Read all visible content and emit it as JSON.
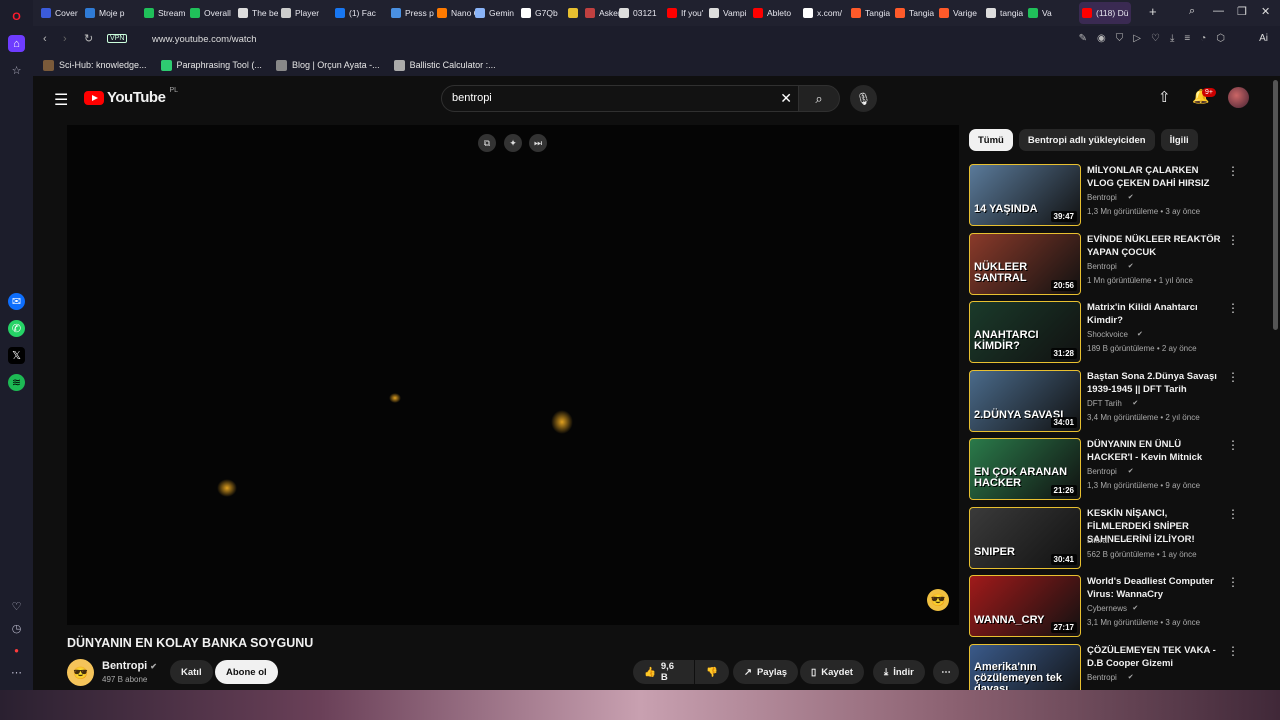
{
  "tabs": [
    {
      "label": "Cover",
      "color": "#3b5bdb"
    },
    {
      "label": "Moje p",
      "color": "#2f7bd6"
    },
    {
      "label": "Stream",
      "color": "#20c05a"
    },
    {
      "label": "Overall",
      "color": "#20c05a"
    },
    {
      "label": "The be",
      "color": "#dddddd"
    },
    {
      "label": "Player",
      "color": "#cccccc"
    },
    {
      "label": "(1) Fac",
      "color": "#1877f2"
    },
    {
      "label": "Press p",
      "color": "#4a90e2"
    },
    {
      "label": "Nano C",
      "color": "#ff7a00"
    },
    {
      "label": "Gemin",
      "color": "#8ab4f8"
    },
    {
      "label": "G7Qb",
      "color": "#ffffff"
    },
    {
      "label": "",
      "color": "#e8c030"
    },
    {
      "label": "Askerl",
      "color": "#c04040"
    },
    {
      "label": "03121",
      "color": "#dddddd"
    },
    {
      "label": "If you'",
      "color": "#ff0000"
    },
    {
      "label": "Vampi",
      "color": "#dddddd"
    },
    {
      "label": "Ableto",
      "color": "#ff0000"
    },
    {
      "label": "x.com/",
      "color": "#ffffff"
    },
    {
      "label": "Tangia",
      "color": "#ff5a2a"
    },
    {
      "label": "Tangia",
      "color": "#ff5a2a"
    },
    {
      "label": "Varige",
      "color": "#ff5a2a"
    },
    {
      "label": "tangia",
      "color": "#dddddd"
    },
    {
      "label": "Va",
      "color": "#20c05a"
    },
    {
      "label": "(118) Dü",
      "color": "#ff0000"
    }
  ],
  "address": {
    "vpn": "VPN",
    "url": "www.youtube.com/watch",
    "ai": "Ai"
  },
  "bookmarks": [
    {
      "label": "Sci-Hub: knowledge...",
      "color": "#7a5a3a"
    },
    {
      "label": "Paraphrasing Tool (...",
      "color": "#2ecc71"
    },
    {
      "label": "Blog | Orçun Ayata -...",
      "color": "#888888"
    },
    {
      "label": "Ballistic Calculator :...",
      "color": "#aaaaaa"
    }
  ],
  "youtube": {
    "logo": "YouTube",
    "region": "PL",
    "search_value": "bentropi",
    "notif_count": "9+"
  },
  "video": {
    "title": "DÜNYANIN EN KOLAY BANKA SOYGUNU",
    "channel": "Bentropi",
    "subscribers": "497 B abone",
    "join": "Katıl",
    "subscribe": "Abone ol",
    "likes": "9,6 B",
    "share": "Paylaş",
    "save": "Kaydet",
    "download": "İndir"
  },
  "chips": [
    "Tümü",
    "Bentropi adlı yükleyiciden",
    "İlgili"
  ],
  "recommendations": [
    {
      "title": "MİLYONLAR ÇALARKEN VLOG ÇEKEN DAHİ HIRSIZ",
      "channel": "Bentropi",
      "meta": "1,3 Mn görüntüleme • 3 ay önce",
      "duration": "39:47",
      "thumb_text": "14 YAŞINDA",
      "bg": "#5a7a9a"
    },
    {
      "title": "EVİNDE NÜKLEER REAKTÖR YAPAN ÇOCUK",
      "channel": "Bentropi",
      "meta": "1 Mn görüntüleme • 1 yıl önce",
      "duration": "20:56",
      "thumb_text": "NÜKLEER SANTRAL",
      "bg": "#8a3a2a"
    },
    {
      "title": "Matrix'in Kilidi Anahtarcı Kimdir?",
      "channel": "Shockvoice",
      "meta": "189 B görüntüleme • 2 ay önce",
      "duration": "31:28",
      "thumb_text": "ANAHTARCI KİMDİR?",
      "bg": "#1a3a2a"
    },
    {
      "title": "Baştan Sona 2.Dünya Savaşı 1939-1945 || DFT Tarih",
      "channel": "DFT Tarih",
      "meta": "3,4 Mn görüntüleme • 2 yıl önce",
      "duration": "34:01",
      "thumb_text": "2.DÜNYA SAVAŞI",
      "bg": "#4a6a8a"
    },
    {
      "title": "DÜNYANIN EN ÜNLÜ HACKER'I - Kevin Mitnick",
      "channel": "Bentropi",
      "meta": "1,3 Mn görüntüleme • 9 ay önce",
      "duration": "21:26",
      "thumb_text": "EN ÇOK ARANAN HACKER",
      "bg": "#2a7a4a"
    },
    {
      "title": "KESKİN NİŞANCI, FİLMLERDEKİ SNİPER SAHNELERİNİ İZLİYOR!",
      "channel": "Literat",
      "meta": "562 B görüntüleme • 1 ay önce",
      "duration": "30:41",
      "thumb_text": "SNIPER",
      "bg": "#3a3a3a"
    },
    {
      "title": "World's Deadliest Computer Virus: WannaCry",
      "channel": "Cybernews",
      "meta": "3,1 Mn görüntüleme • 3 ay önce",
      "duration": "27:17",
      "thumb_text": "WANNA_CRY",
      "bg": "#a01a1a"
    },
    {
      "title": "ÇÖZÜLEMEYEN TEK VAKA - D.B Cooper Gizemi",
      "channel": "Bentropi",
      "meta": "",
      "duration": "",
      "thumb_text": "Amerika'nın çözülemeyen tek davası",
      "bg": "#3a5a8a"
    }
  ]
}
